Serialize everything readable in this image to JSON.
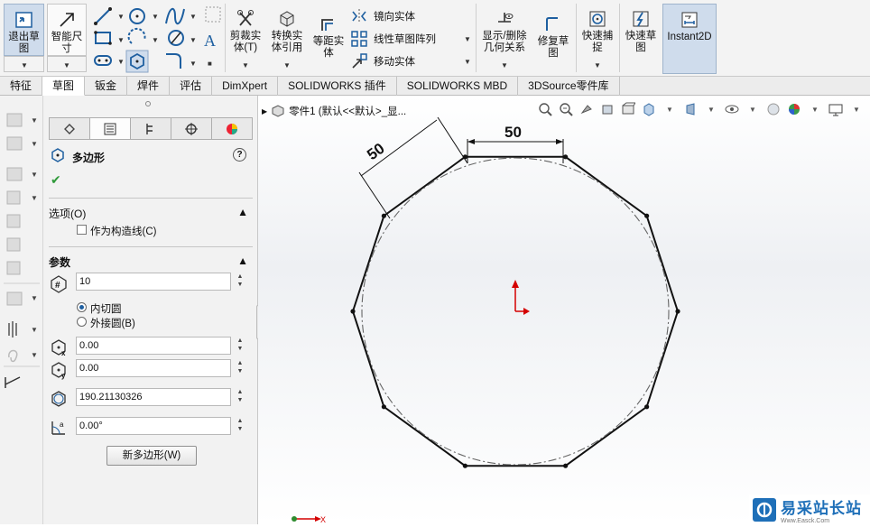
{
  "ribbon": {
    "exit_sketch": "退出草图",
    "smart_dim": "智能尺寸",
    "trim": "剪裁实体(T)",
    "convert": "转换实体引用",
    "offset": "等距实体",
    "mirror": "镜向实体",
    "linear_pattern": "线性草图阵列",
    "move": "移动实体",
    "display_relations": "显示/删除几何关系",
    "repair": "修复草图",
    "quick_snap": "快速捕捉",
    "rapid_sketch": "快速草图",
    "instant2d": "Instant2D"
  },
  "tabs": [
    "特征",
    "草图",
    "钣金",
    "焊件",
    "评估",
    "DimXpert",
    "SOLIDWORKS 插件",
    "SOLIDWORKS MBD",
    "3DSource零件库"
  ],
  "active_tab": "草图",
  "panel": {
    "title": "多边形",
    "help": "?",
    "ok": "✔",
    "options_header": "选项(O)",
    "construction_label": "作为构造线(C)",
    "params_header": "参数",
    "sides": "10",
    "inscribed": "内切圆",
    "circumscribed": "外接圆(B)",
    "center_x": "0.00",
    "center_y": "0.00",
    "diameter": "190.21130326",
    "angle": "0.00°",
    "new_polygon": "新多边形(W)"
  },
  "viewport": {
    "breadcrumb": "零件1 (默认<<默认>_显...",
    "dim_top": "50",
    "dim_left": "50",
    "axis_label": "X"
  },
  "watermark": {
    "title": "易采站长站",
    "sub": "Www.Easck.Com"
  },
  "colors": {
    "accent": "#1e6fb8",
    "origin": "#d40000",
    "axis": "#2e8b2e"
  }
}
